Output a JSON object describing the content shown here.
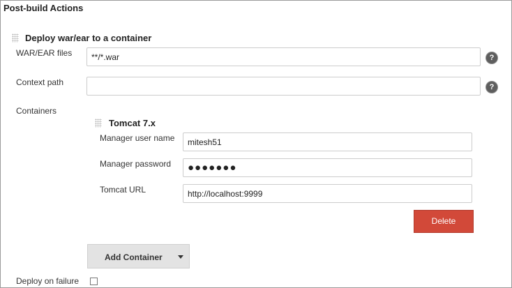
{
  "section": {
    "title": "Post-build Actions"
  },
  "deploy": {
    "title": "Deploy war/ear to a container",
    "war_label": "WAR/EAR files",
    "war_value": "**/*.war",
    "context_label": "Context path",
    "context_value": "",
    "help_glyph": "?",
    "containers_label": "Containers"
  },
  "tomcat": {
    "title": "Tomcat 7.x",
    "user_label": "Manager user name",
    "user_value": "mitesh51",
    "password_label": "Manager password",
    "password_value": "●●●●●●●",
    "url_label": "Tomcat URL",
    "url_value": "http://localhost:9999",
    "delete_label": "Delete"
  },
  "add_container": {
    "label": "Add Container"
  },
  "deploy_on_failure": {
    "label": "Deploy on failure",
    "checked": false
  },
  "colors": {
    "delete_button": "#d24939",
    "add_button": "#e3e3e3",
    "help_icon": "#5e5e5e"
  }
}
